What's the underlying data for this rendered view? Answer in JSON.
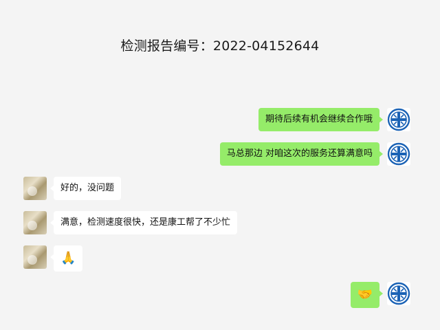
{
  "header": {
    "title": "检测报告编号：2022-04152644"
  },
  "messages": [
    {
      "side": "right",
      "text": "期待后续有机会继续合作哦"
    },
    {
      "side": "right",
      "text": "马总那边 对咱这次的服务还算满意吗"
    },
    {
      "side": "left",
      "text": "好的，没问题"
    },
    {
      "side": "left",
      "text": "满意，检测速度很快，还是康工帮了不少忙"
    },
    {
      "side": "left",
      "text": "🙏"
    },
    {
      "side": "right",
      "text": "🤝"
    }
  ],
  "colors": {
    "background": "#f4f4f4",
    "sent_bubble": "#95ec69",
    "received_bubble": "#ffffff",
    "logo_blue": "#1a62b5"
  },
  "icons": {
    "sender_avatar": "company-logo-icon",
    "receiver_avatar": "profile-photo"
  }
}
